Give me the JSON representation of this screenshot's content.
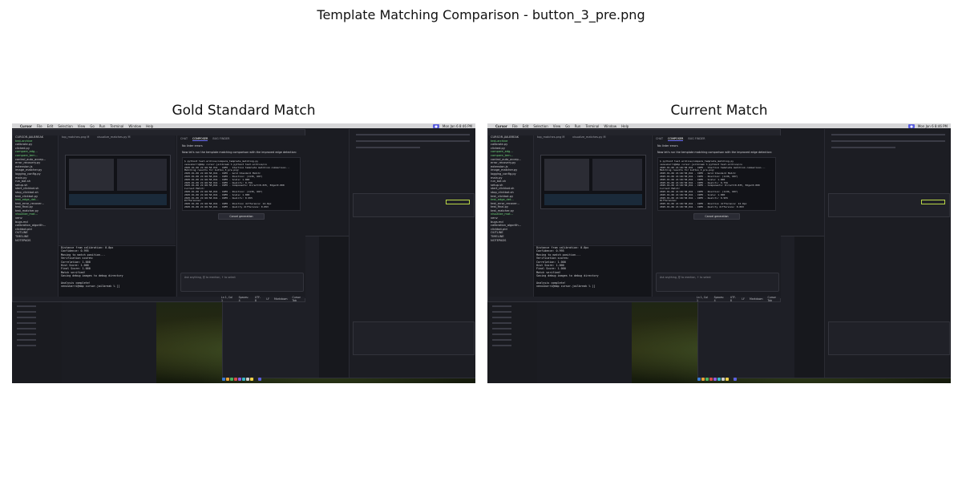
{
  "figure": {
    "title": "Template Matching Comparison - button_3_pre.png"
  },
  "panels": [
    {
      "title": "Gold Standard Match"
    },
    {
      "title": "Current Match"
    }
  ],
  "screenshot": {
    "menubar": {
      "app_name": "Cursor",
      "items": [
        "File",
        "Edit",
        "Selection",
        "View",
        "Go",
        "Run",
        "Terminal",
        "Window",
        "Help"
      ],
      "clock": "Mon Jan 6  8:46 PM"
    },
    "sidebar": {
      "header": "CURSOR-JAILBREAK",
      "files": [
        {
          "name": "test-archive",
          "green": true
        },
        {
          "name": "calibrate.py",
          "green": false
        },
        {
          "name": "clicked.py",
          "green": false
        },
        {
          "name": "compare_edg...",
          "green": true
        },
        {
          "name": "compare_tem...",
          "green": true
        },
        {
          "name": "control_auto_accep...",
          "green": false
        },
        {
          "name": "error_recovery.py",
          "green": false
        },
        {
          "name": "extension.js",
          "green": false
        },
        {
          "name": "image_matcher.py",
          "green": false
        },
        {
          "name": "logging_config.py",
          "green": false
        },
        {
          "name": "main.py",
          "green": false
        },
        {
          "name": "run_bot.sh",
          "green": false
        },
        {
          "name": "setup.sh",
          "green": false
        },
        {
          "name": "start_clickbot.sh",
          "green": false
        },
        {
          "name": "stop_clickbot.sh",
          "green": false
        },
        {
          "name": "test_clickbot.py",
          "green": false
        },
        {
          "name": "test_edge_det...",
          "green": true
        },
        {
          "name": "test_error_recover...",
          "green": false
        },
        {
          "name": "test_final.py",
          "green": false
        },
        {
          "name": "test_matcher.py",
          "green": false
        },
        {
          "name": "visualize_mat...",
          "green": true
        },
        {
          "name": "venv",
          "green": false
        },
        {
          "name": "bugs.md",
          "green": false
        },
        {
          "name": "calibration_algorith...",
          "green": false
        },
        {
          "name": "clickbot.pid",
          "green": false
        },
        {
          "name": "OUTLINE",
          "green": false
        },
        {
          "name": "TIMELINE",
          "green": false
        },
        {
          "name": "NOTEPADS",
          "green": false
        }
      ]
    },
    "editor_tabs": [
      "top_matches.png M",
      "visualize_matches.py M"
    ],
    "terminal_lines": [
      "Distance from calibration: 0.0px",
      "Confidence: 0.995",
      "Moving to match position...",
      "Verification scores:",
      "  Correlation: 1.000",
      "  Hist Score: 1.000",
      "  Final Score: 1.000",
      "Match verified!",
      "Saving debug images to debug directory",
      "",
      "Analysis complete!",
      "venuskarri@mbp cursor-jailbreak % []"
    ],
    "chat": {
      "tabs": [
        "CHAT",
        "COMPOSER",
        "BUG FINDER"
      ],
      "no_linter": "No linter errors",
      "intro": "Now let's run the template matching comparison with the improved edge detection:",
      "command": "$ python3 test-archive/compare_template_matching.py",
      "log_lines": [
        "venuskarri@mbp cursor-jailbreak % python3 test-archive/co",
        "2025-01-06 21:46:58,041 - INFO - Starting template matching comparison...",
        "Matching results for button_3_pre.png:",
        "2025-01-06 21:46:58,041 - INFO - Gold Standard Match:",
        "2025-01-06 21:46:58,041 - INFO -   Position: (1136, 607)",
        "2025-01-06 21:46:58,041 - INFO -   Scale: 1.000",
        "2025-01-06 21:46:58,041 - INFO -   Quality: 0.756",
        "2025-01-06 21:46:58,041 - INFO -   Components: Direct=0.835, Edge=0.000",
        "Current Match:",
        "2025-01-06 21:46:58,041 - INFO -   Position: (1136, 607)",
        "2025-01-06 21:46:58,041 - INFO -   Scale: 1.000",
        "2025-01-06 21:46:58,041 - INFO -   Quality: 0.955",
        "Differences:",
        "2025-01-06 21:46:58,041 - INFO -   Position difference: 12.0px",
        "2025-01-06 21:46:58,041 - INFO -   Quality difference: 0.093"
      ],
      "cancel_button": "Cancel generation",
      "input_placeholder": "Ask anything, @ to mention, ↑ to select"
    },
    "status": {
      "cursor": "Ln 1, Col 1",
      "spaces": "Spaces: 4",
      "encoding": "UTF-8",
      "eol": "LF",
      "lang": "Markdown",
      "tab": "Cursor Tab"
    }
  }
}
